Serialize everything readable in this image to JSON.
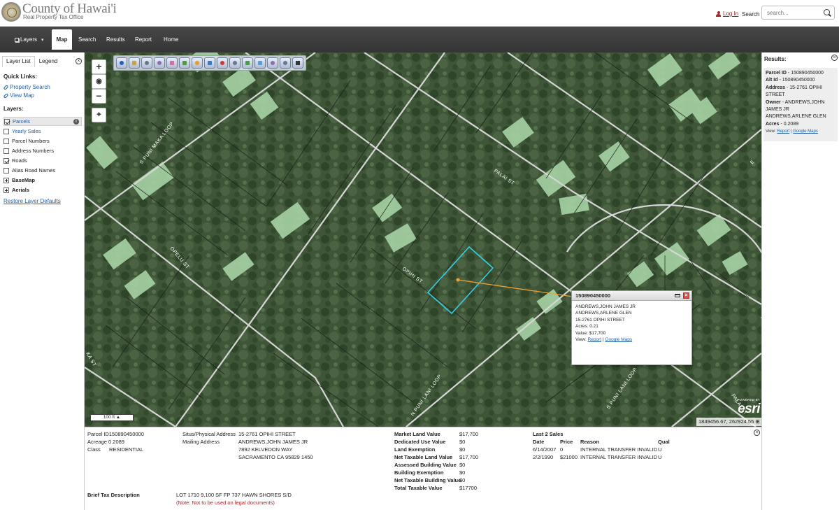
{
  "header": {
    "brand_title": "County of Hawai'i",
    "brand_subtitle": "Real Property Tax Office",
    "login_label": "Log In",
    "search_label": "Search",
    "search_placeholder": "search..."
  },
  "nav": {
    "layers": "Layers",
    "map": "Map",
    "search": "Search",
    "results": "Results",
    "report": "Report",
    "home": "Home"
  },
  "left_panel": {
    "tab_layer_list": "Layer List",
    "tab_legend": "Legend",
    "quick_links_heading": "Quick Links:",
    "quick_links": [
      "Property Search",
      "View Map"
    ],
    "layers_heading": "Layers:",
    "layers": [
      {
        "label": "Parcels",
        "checked": true
      },
      {
        "label": "Yearly Sales",
        "checked": false
      },
      {
        "label": "Parcel Numbers",
        "checked": false
      },
      {
        "label": "Address Numbers",
        "checked": false
      },
      {
        "label": "Roads",
        "checked": true
      },
      {
        "label": "Alias Road Names",
        "checked": false
      },
      {
        "label": "BaseMap",
        "group": true
      },
      {
        "label": "Aerials",
        "group": true
      }
    ],
    "restore": "Restore Layer Defaults"
  },
  "map": {
    "streets": [
      "S PUNI MAKA LOOP",
      "PALAI ST",
      "OPELU ST",
      "OPIHI ST",
      "N PUNI LANI LOOP",
      "S PUNI LANI LOOP",
      "PALAI ST",
      "E",
      "KA ST"
    ],
    "scale": "100 ft",
    "coords": "1849456.67, 262924.55",
    "esri_small": "POWERED BY",
    "esri_big": "esri",
    "colors": {
      "selected_parcel": "#35d0e6",
      "leader_line": "#f0a030"
    }
  },
  "popup": {
    "title": "150890450000",
    "lines": [
      "ANDREWS,JOHN JAMES JR",
      "ANDREWS,ARLENE GLEN",
      "15-2761 OPIHI STREET",
      "Acres: 0.21",
      "Value: $17,700"
    ],
    "view_label": "View:",
    "report_link": "Report",
    "sep": "|",
    "google_link": "Google Maps"
  },
  "results": {
    "title": "Results:",
    "parcel_id_label": "Parcel ID",
    "parcel_id": "150890450000",
    "alt_id_label": "Alt Id",
    "alt_id": "150890450000",
    "address_label": "Address",
    "address": "15-2761 OPIHI STREET",
    "owner_label": "Owner",
    "owner": "ANDREWS,JOHN JAMES JR ANDREWS,ARLENE GLEN",
    "acres_label": "Acres",
    "acres": "0.2089",
    "dash": " - ",
    "view_label": "View:",
    "report_link": "Report",
    "sep": "|",
    "google_link": "Google Maps"
  },
  "details": {
    "parcel_id_label": "Parcel ID",
    "parcel_id": "150890450000",
    "acreage_label": "Acreage",
    "acreage": "0.2089",
    "class_label": "Class",
    "class": "RESIDENTIAL",
    "situs_label": "Situs/Physical Address",
    "situs": "15-2761 OPIHI STREET",
    "mailing_label": "Mailing Address",
    "mailing": [
      "ANDREWS,JOHN JAMES JR",
      "7892 KELVEDON WAY",
      "SACRAMENTO CA 95829 1450"
    ],
    "values": [
      {
        "label": "Market Land Value",
        "value": "$17,700"
      },
      {
        "label": "Dedicated Use Value",
        "value": "$0"
      },
      {
        "label": "Land Exemption",
        "value": "$0"
      },
      {
        "label": "Net Taxable Land Value",
        "value": "$17,700"
      },
      {
        "label": "Assessed Building Value",
        "value": "$0"
      },
      {
        "label": "Building Exemption",
        "value": "$0"
      },
      {
        "label": "Net Taxable Building Value",
        "value": "$0"
      },
      {
        "label": "Total Taxable Value",
        "value": "$17700"
      }
    ],
    "sales_title": "Last 2 Sales",
    "sales_headers": [
      "Date",
      "Price",
      "Reason",
      "Qual"
    ],
    "sales": [
      [
        "6/14/2007",
        "0",
        "INTERNAL TRANSFER INVALID",
        "U"
      ],
      [
        "2/2/1990",
        "$21000",
        "INTERNAL TRANSFER INVALID",
        "U"
      ]
    ],
    "brief_label": "Brief Tax Description",
    "brief": "LOT 1710 9,100 SF FP 737 HAWN SHORES S/D",
    "note": "(Note: Not to be used on legal documents)"
  }
}
